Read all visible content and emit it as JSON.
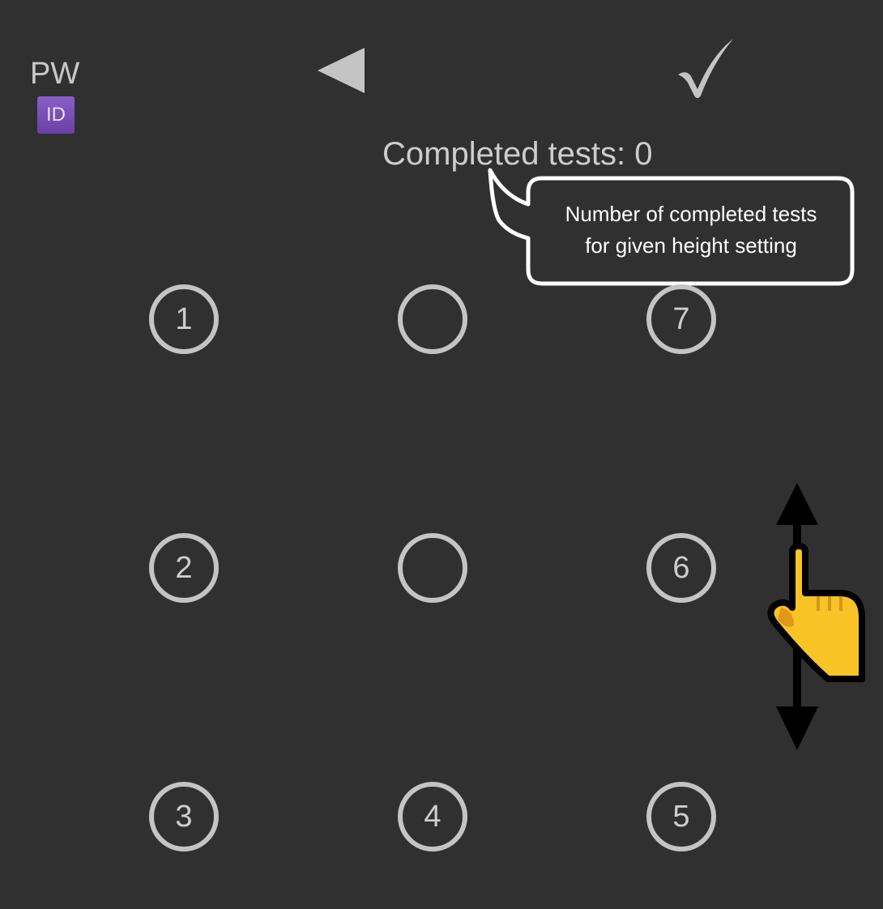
{
  "header": {
    "account_label": "PW",
    "badge_label": "ID",
    "back_icon": "triangle-left-icon",
    "confirm_icon": "check-mark-icon"
  },
  "status": {
    "completed_text": "Completed tests: 0"
  },
  "tooltip": {
    "line1": "Number of completed tests",
    "line2": "for given height setting"
  },
  "grid": {
    "dots": [
      {
        "label": "1"
      },
      {
        "label": ""
      },
      {
        "label": "7"
      },
      {
        "label": "2"
      },
      {
        "label": ""
      },
      {
        "label": "6"
      },
      {
        "label": "3"
      },
      {
        "label": "4"
      },
      {
        "label": "5"
      }
    ]
  },
  "gesture": {
    "icon": "swipe-vertical-hand-icon"
  },
  "colors": {
    "background": "#303030",
    "foreground": "#c4c4c4",
    "badge": "#7b4fbc",
    "hand": "#f7c325"
  }
}
